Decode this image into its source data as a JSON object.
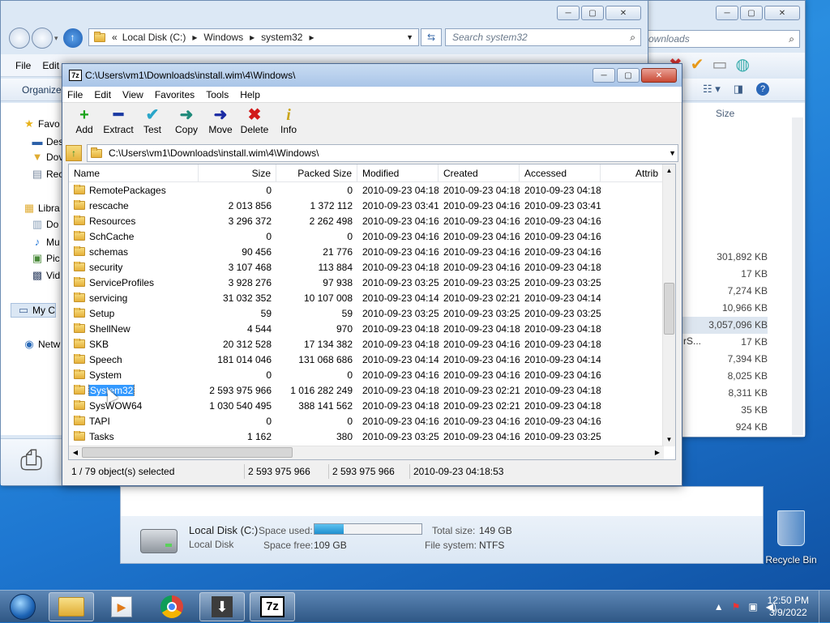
{
  "explorer_bg": {
    "address": {
      "crumbs": [
        "Local Disk (C:)",
        "Windows",
        "system32"
      ],
      "chevron": "«"
    },
    "search_placeholder": "Search system32",
    "menu": [
      "File",
      "Edit"
    ],
    "organize_label": "Organize",
    "nav": [
      {
        "label": "Favo",
        "icon": "star-icon"
      },
      {
        "label": "Des",
        "icon": "desktop-icon"
      },
      {
        "label": "Dov",
        "icon": "downloads-icon"
      },
      {
        "label": "Rec",
        "icon": "recent-icon"
      },
      {
        "label": "Libra",
        "icon": "library-icon"
      },
      {
        "label": "Do",
        "icon": "documents-icon"
      },
      {
        "label": "Mu",
        "icon": "music-icon"
      },
      {
        "label": "Pic",
        "icon": "pictures-icon"
      },
      {
        "label": "Vid",
        "icon": "videos-icon"
      },
      {
        "label": "My C",
        "icon": "computer-icon"
      },
      {
        "label": "Netw",
        "icon": "network-icon"
      }
    ]
  },
  "explorer_right": {
    "search_fragment": "ownloads",
    "size_header": "Size",
    "sizes": [
      "301,892 KB",
      "17 KB",
      "7,274 KB",
      "10,966 KB",
      "3,057,096 KB",
      "17 KB",
      "7,394 KB",
      "8,025 KB",
      "8,311 KB",
      "35 KB",
      "924 KB"
    ],
    "fragment": "rS..."
  },
  "drive_panel": {
    "name": "Local Disk (C:)",
    "type": "Local Disk",
    "space_used_label": "Space used:",
    "space_free_label": "Space free:",
    "space_free_value": "109 GB",
    "total_size_label": "Total size:",
    "total_size_value": "149 GB",
    "file_system_label": "File system:",
    "file_system_value": "NTFS",
    "used_fraction": 0.27
  },
  "sevenzip": {
    "title": "C:\\Users\\vm1\\Downloads\\install.wim\\4\\Windows\\",
    "menu": [
      "File",
      "Edit",
      "View",
      "Favorites",
      "Tools",
      "Help"
    ],
    "toolbar": [
      {
        "label": "Add",
        "icon": "add-icon",
        "glyph": "+",
        "color": "#1aa31a"
      },
      {
        "label": "Extract",
        "icon": "extract-icon",
        "glyph": "━",
        "color": "#1a3aa3"
      },
      {
        "label": "Test",
        "icon": "test-icon",
        "glyph": "✔",
        "color": "#2aa6c9"
      },
      {
        "label": "Copy",
        "icon": "copy-icon",
        "glyph": "➜",
        "color": "#1f8a7a"
      },
      {
        "label": "Move",
        "icon": "move-icon",
        "glyph": "➜",
        "color": "#1a2aa3"
      },
      {
        "label": "Delete",
        "icon": "delete-icon",
        "glyph": "✖",
        "color": "#d11a1a"
      },
      {
        "label": "Info",
        "icon": "info-icon",
        "glyph": "i",
        "color": "#c9a41a"
      }
    ],
    "path": "C:\\Users\\vm1\\Downloads\\install.wim\\4\\Windows\\",
    "columns": [
      "Name",
      "Size",
      "Packed Size",
      "Modified",
      "Created",
      "Accessed",
      "Attrib"
    ],
    "rows": [
      {
        "name": "RemotePackages",
        "size": "0",
        "packed": "0",
        "modified": "2010-09-23 04:18",
        "created": "2010-09-23 04:18",
        "accessed": "2010-09-23 04:18"
      },
      {
        "name": "rescache",
        "size": "2 013 856",
        "packed": "1 372 112",
        "modified": "2010-09-23 03:41",
        "created": "2010-09-23 04:16",
        "accessed": "2010-09-23 03:41"
      },
      {
        "name": "Resources",
        "size": "3 296 372",
        "packed": "2 262 498",
        "modified": "2010-09-23 04:16",
        "created": "2010-09-23 04:16",
        "accessed": "2010-09-23 04:16"
      },
      {
        "name": "SchCache",
        "size": "0",
        "packed": "0",
        "modified": "2010-09-23 04:16",
        "created": "2010-09-23 04:16",
        "accessed": "2010-09-23 04:16"
      },
      {
        "name": "schemas",
        "size": "90 456",
        "packed": "21 776",
        "modified": "2010-09-23 04:16",
        "created": "2010-09-23 04:16",
        "accessed": "2010-09-23 04:16"
      },
      {
        "name": "security",
        "size": "3 107 468",
        "packed": "113 884",
        "modified": "2010-09-23 04:18",
        "created": "2010-09-23 04:16",
        "accessed": "2010-09-23 04:18"
      },
      {
        "name": "ServiceProfiles",
        "size": "3 928 276",
        "packed": "97 938",
        "modified": "2010-09-23 03:25",
        "created": "2010-09-23 03:25",
        "accessed": "2010-09-23 03:25"
      },
      {
        "name": "servicing",
        "size": "31 032 352",
        "packed": "10 107 008",
        "modified": "2010-09-23 04:14",
        "created": "2010-09-23 02:21",
        "accessed": "2010-09-23 04:14"
      },
      {
        "name": "Setup",
        "size": "59",
        "packed": "59",
        "modified": "2010-09-23 03:25",
        "created": "2010-09-23 03:25",
        "accessed": "2010-09-23 03:25"
      },
      {
        "name": "ShellNew",
        "size": "4 544",
        "packed": "970",
        "modified": "2010-09-23 04:18",
        "created": "2010-09-23 04:18",
        "accessed": "2010-09-23 04:18"
      },
      {
        "name": "SKB",
        "size": "20 312 528",
        "packed": "17 134 382",
        "modified": "2010-09-23 04:18",
        "created": "2010-09-23 04:16",
        "accessed": "2010-09-23 04:18"
      },
      {
        "name": "Speech",
        "size": "181 014 046",
        "packed": "131 068 686",
        "modified": "2010-09-23 04:14",
        "created": "2010-09-23 04:16",
        "accessed": "2010-09-23 04:14"
      },
      {
        "name": "System",
        "size": "0",
        "packed": "0",
        "modified": "2010-09-23 04:16",
        "created": "2010-09-23 04:16",
        "accessed": "2010-09-23 04:16"
      },
      {
        "name": "System32",
        "size": "2 593 975 966",
        "packed": "1 016 282 249",
        "modified": "2010-09-23 04:18",
        "created": "2010-09-23 02:21",
        "accessed": "2010-09-23 04:18",
        "selected": true
      },
      {
        "name": "SysWOW64",
        "size": "1 030 540 495",
        "packed": "388 141 562",
        "modified": "2010-09-23 04:18",
        "created": "2010-09-23 02:21",
        "accessed": "2010-09-23 04:18"
      },
      {
        "name": "TAPI",
        "size": "0",
        "packed": "0",
        "modified": "2010-09-23 04:16",
        "created": "2010-09-23 04:16",
        "accessed": "2010-09-23 04:16"
      },
      {
        "name": "Tasks",
        "size": "1 162",
        "packed": "380",
        "modified": "2010-09-23 03:25",
        "created": "2010-09-23 04:16",
        "accessed": "2010-09-23 03:25"
      }
    ],
    "status": {
      "selection": "1 / 79 object(s) selected",
      "size": "2 593 975 966",
      "packed": "2 593 975 966",
      "modified": "2010-09-23 04:18:53"
    }
  },
  "desktop": {
    "recycle_bin": "Recycle Bin"
  },
  "taskbar": {
    "apps": [
      "start-orb",
      "explorer-icon",
      "media-player-icon",
      "chrome-icon",
      "downloader-icon",
      "7zip-icon"
    ],
    "sevenzip_label": "7z",
    "time": "12:50 PM",
    "date": "3/9/2022"
  }
}
